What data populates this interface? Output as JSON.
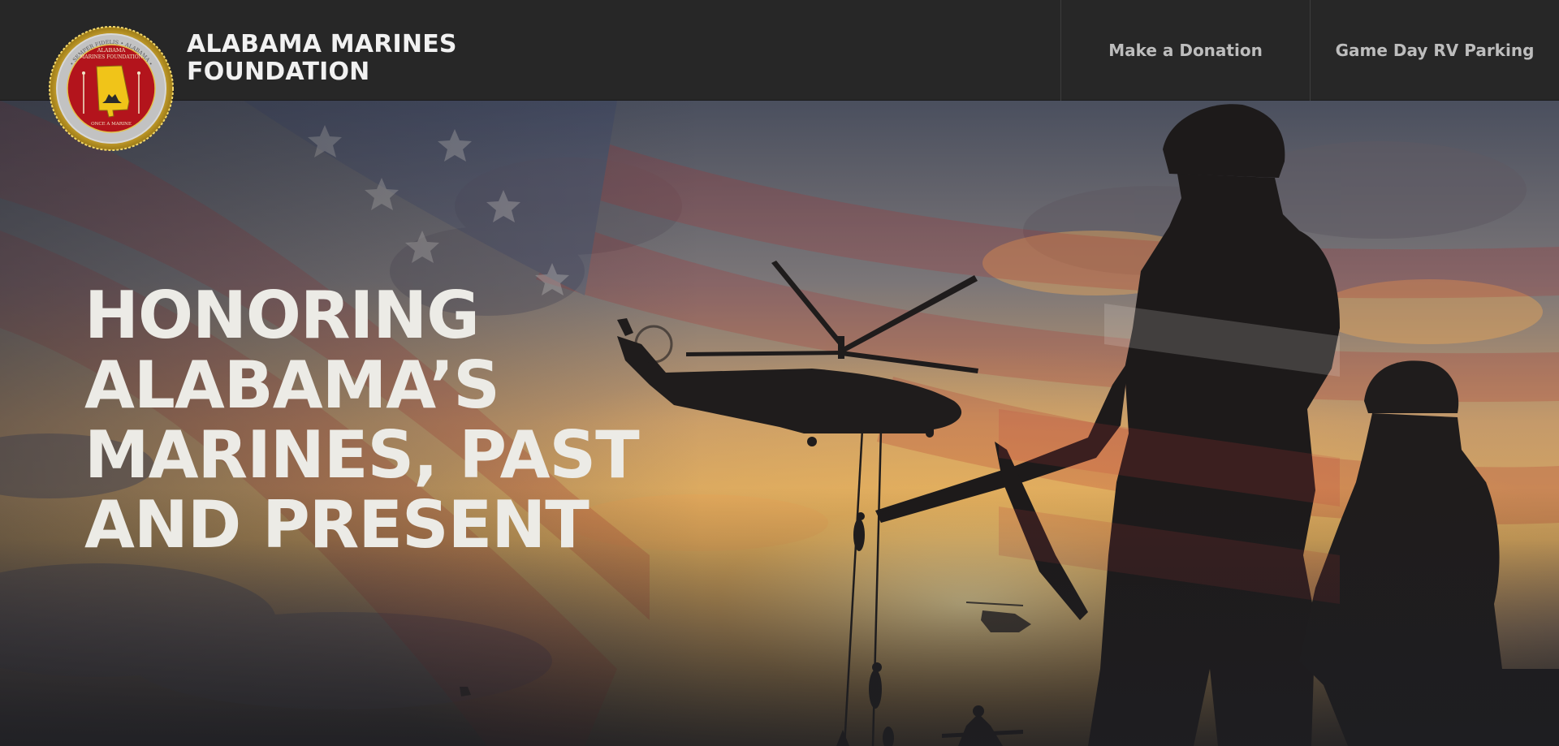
{
  "header": {
    "brand_line1": "ALABAMA MARINES",
    "brand_line2": "FOUNDATION",
    "nav": {
      "donate_label": "Make a Donation",
      "rv_label": "Game Day RV Parking"
    }
  },
  "logo": {
    "text_top_line1": "ALABAMA",
    "text_top_line2": "MARINES FOUNDATION",
    "text_bottom": "ONCE A MARINE"
  },
  "hero": {
    "headline": [
      "HONORING",
      "ALABAMA’S",
      "MARINES, PAST",
      "AND PRESENT"
    ]
  },
  "colors": {
    "header_bg": "#272727",
    "logo_red": "#b3141c",
    "logo_gold": "#e0b92a",
    "headline": "#ecebe6",
    "nav_text": "#bdbdbd"
  }
}
